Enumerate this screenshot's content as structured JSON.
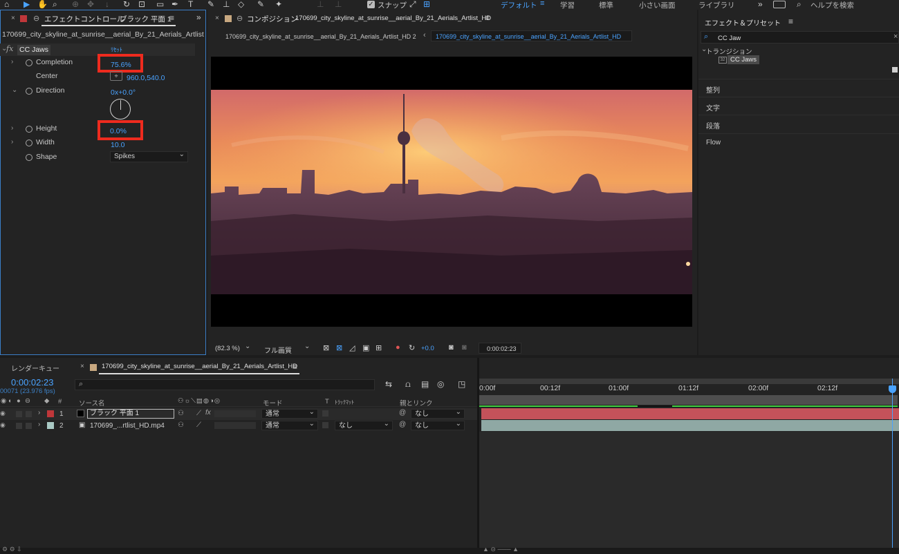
{
  "toolbar": {
    "snap_label": "スナップ",
    "workspaces": [
      "デフォルト",
      "学習",
      "標準",
      "小さい画面",
      "ライブラリ"
    ],
    "search_placeholder": "ヘルプを検索"
  },
  "effect_controls": {
    "tab_title": "エフェクトコントロール",
    "layer_name": "ブラック 平面 1",
    "clip_name": "170699_city_skyline_at_sunrise__aerial_By_21_Aerials_Artlist",
    "fx_label": "fx",
    "effect_name": "CC Jaws",
    "reset_label": "ﾘｾｯﾄ",
    "properties": [
      {
        "label": "Completion",
        "value": "75.6%"
      },
      {
        "label": "Center",
        "value": "960.0,540.0"
      },
      {
        "label": "Direction",
        "value": "0x+0.0°"
      },
      {
        "label": "Height",
        "value": "0.0%"
      },
      {
        "label": "Width",
        "value": "10.0"
      },
      {
        "label": "Shape",
        "value": "Spikes"
      }
    ]
  },
  "composition": {
    "tab_prefix": "コンポジション",
    "tab_title": "170699_city_skyline_at_sunrise__aerial_By_21_Aerials_Artlist_HD",
    "breadcrumb_1": "170699_city_skyline_at_sunrise__aerial_By_21_Aerials_Artlist_HD 2",
    "breadcrumb_2": "170699_city_skyline_at_sunrise__aerial_By_21_Aerials_Artlist_HD",
    "zoom": "(82.3 %)",
    "resolution": "フル画質",
    "exposure": "+0.0",
    "timecode": "0:00:02:23"
  },
  "effects_presets": {
    "title": "エフェクト＆プリセット",
    "search_value": "CC Jaw",
    "category": "トランジション",
    "result": "CC Jaws",
    "sections": [
      "整列",
      "文字",
      "段落",
      "Flow"
    ]
  },
  "render_queue": {
    "title": "レンダーキュー"
  },
  "timeline": {
    "tab_title": "170699_city_skyline_at_sunrise__aerial_By_21_Aerials_Artlist_HD",
    "timecode": "0:00:02:23",
    "frame_info": "00071 (23.976 fps)",
    "headers": {
      "source": "ソース名",
      "mode": "モード",
      "t": "T",
      "track_matte": "ﾄﾗｯｸﾏｯﾄ",
      "parent": "親とリンク"
    },
    "layers": [
      {
        "num": "1",
        "name": "ブラック 平面 1",
        "mode": "通常",
        "matte": "",
        "parent": "なし",
        "color": "#c0373a"
      },
      {
        "num": "2",
        "name": "170699_...rtlist_HD.mp4",
        "mode": "通常",
        "matte": "なし",
        "parent": "なし",
        "color": "#a9c9c4"
      }
    ],
    "ruler": [
      "0:00f",
      "00:12f",
      "01:00f",
      "01:12f",
      "02:00f",
      "02:12f"
    ]
  },
  "colors": {
    "accent": "#4aa3ff",
    "highlight_box": "#ee2b1e",
    "layer1_bar": "#c4525a",
    "layer2_bar": "#8fa8a4",
    "work_area_green": "#3ecf3e"
  }
}
